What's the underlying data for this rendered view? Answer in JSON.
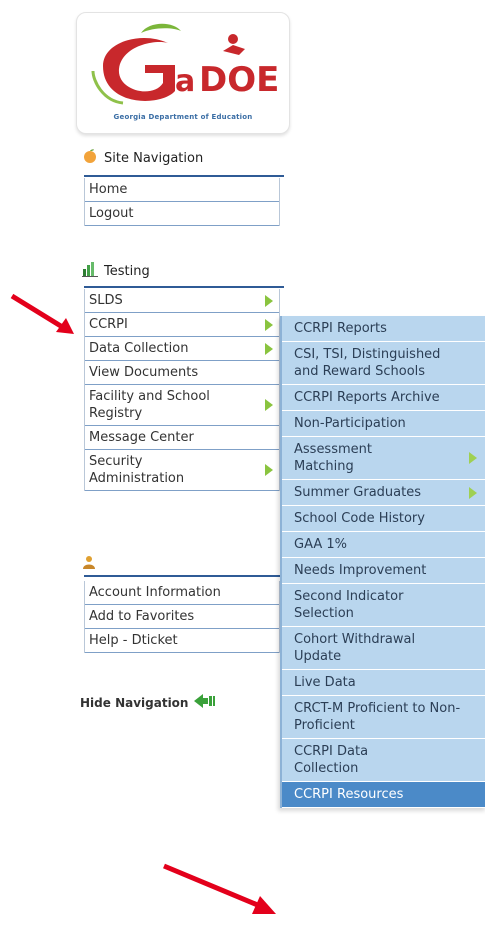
{
  "logo": {
    "brand": "GaDOE",
    "subtitle": "Georgia Department of Education"
  },
  "site_navigation": {
    "title": "Site Navigation",
    "items": [
      {
        "label": "Home"
      },
      {
        "label": "Logout"
      }
    ]
  },
  "testing": {
    "title": "Testing",
    "items": [
      {
        "label": "SLDS",
        "has_submenu": true
      },
      {
        "label": "CCRPI",
        "has_submenu": true
      },
      {
        "label": "Data Collection",
        "has_submenu": true
      },
      {
        "label": "View Documents",
        "has_submenu": false
      },
      {
        "label": "Facility and School Registry",
        "has_submenu": true
      },
      {
        "label": "Message Center",
        "has_submenu": false
      },
      {
        "label": "Security Administration",
        "has_submenu": true
      }
    ]
  },
  "account": {
    "items": [
      {
        "label": "Account Information"
      },
      {
        "label": "Add to Favorites"
      },
      {
        "label": "Help - Dticket"
      }
    ]
  },
  "hide_navigation": {
    "label": "Hide Navigation"
  },
  "ccrpi_submenu": {
    "items": [
      {
        "label": "CCRPI Reports"
      },
      {
        "label": "CSI, TSI, Distinguished and Reward Schools"
      },
      {
        "label": "CCRPI Reports Archive"
      },
      {
        "label": "Non-Participation"
      },
      {
        "label": "Assessment Matching"
      },
      {
        "label": "Summer Graduates"
      },
      {
        "label": "School Code History"
      },
      {
        "label": "GAA 1%"
      },
      {
        "label": "Needs Improvement"
      },
      {
        "label": "Second Indicator Selection"
      },
      {
        "label": "Cohort Withdrawal Update"
      },
      {
        "label": "Live Data"
      },
      {
        "label": "CRCT-M Proficient to Non-Proficient"
      },
      {
        "label": "CCRPI Data Collection"
      },
      {
        "label": "CCRPI Resources"
      }
    ],
    "active_item": "CCRPI Resources"
  },
  "colors": {
    "accent_blue": "#2f5b96",
    "submenu_bg": "#b9d6ee",
    "active_bg": "#4b8ac8",
    "arrow_green": "#8ac43f",
    "annotation_red": "#e3001b"
  }
}
